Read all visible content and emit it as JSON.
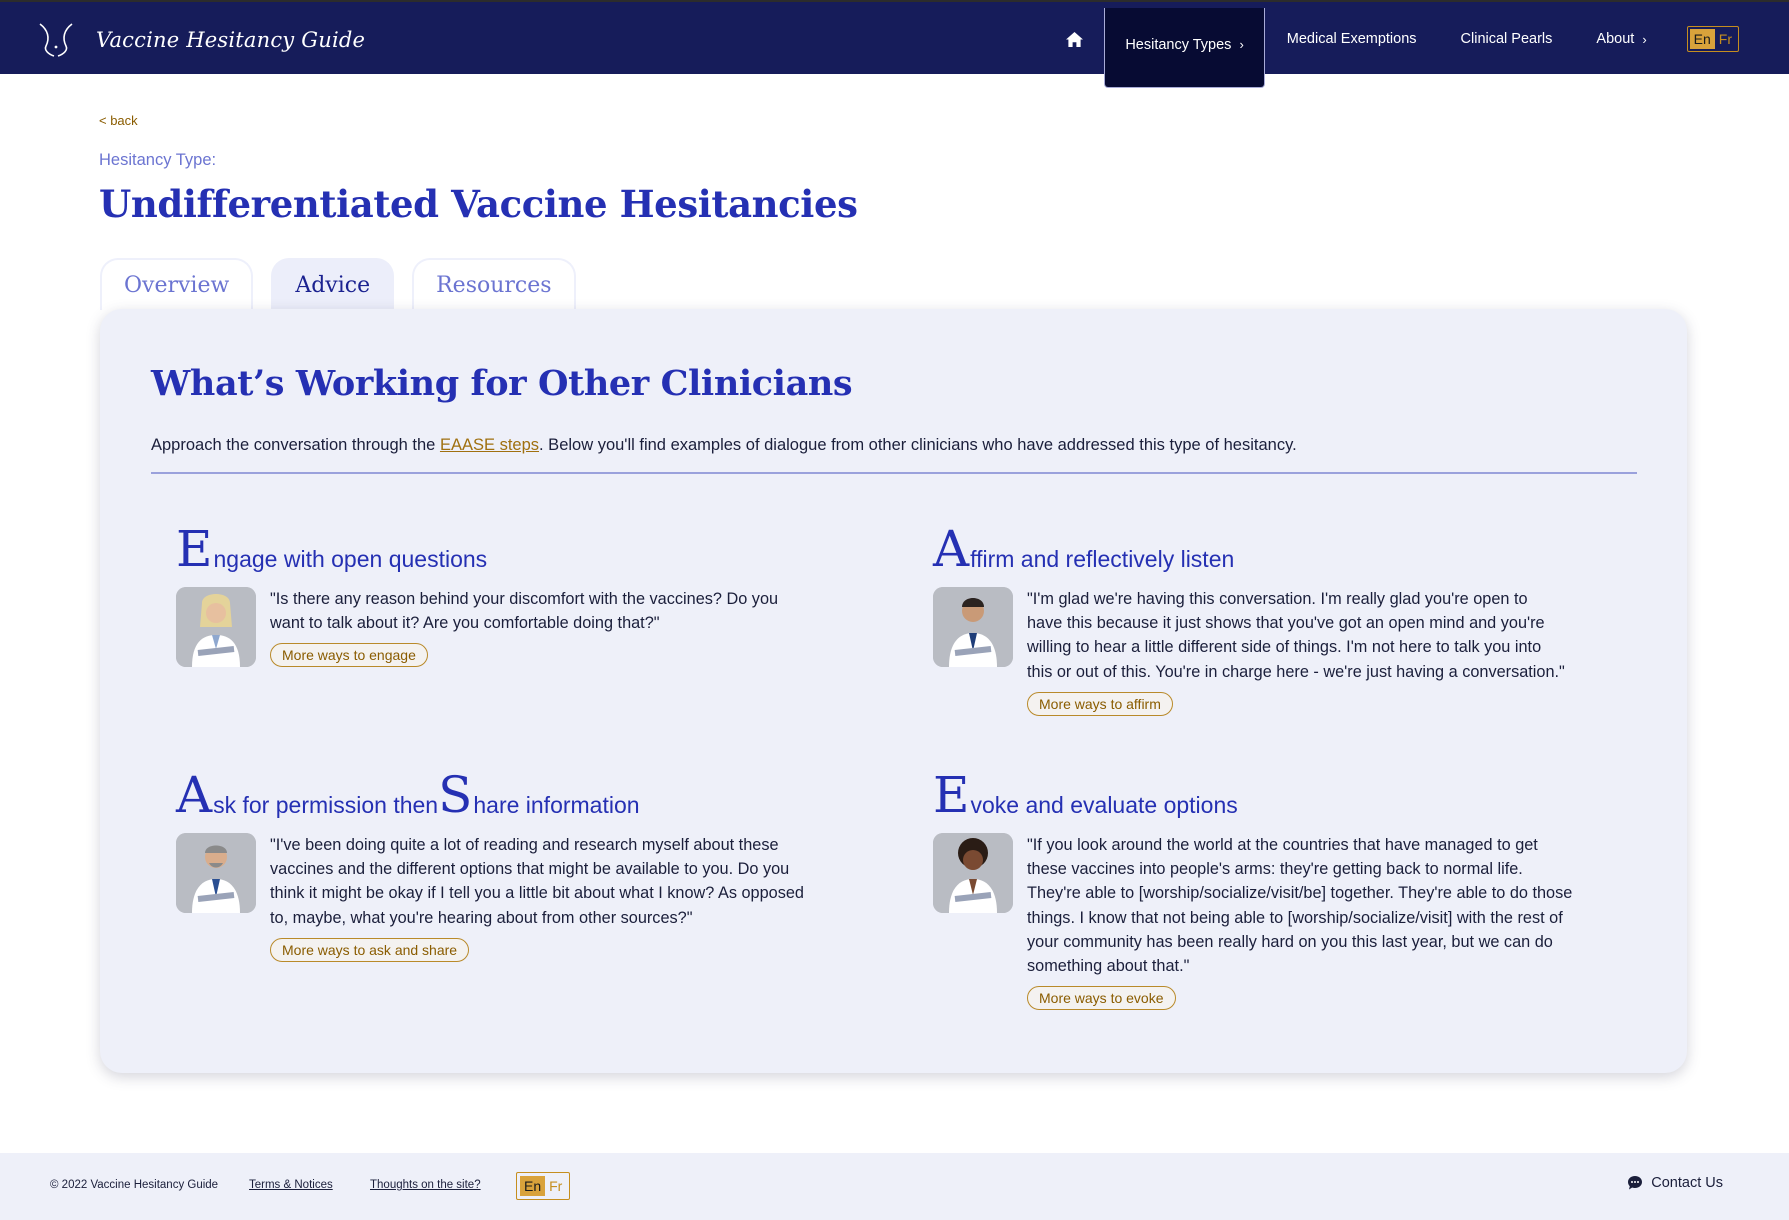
{
  "header": {
    "brand": "Vaccine Hesitancy Guide",
    "nav": [
      {
        "label": "Hesitancy Types",
        "active": true,
        "chevron": true
      },
      {
        "label": "Medical Exemptions",
        "active": false,
        "chevron": false
      },
      {
        "label": "Clinical Pearls",
        "active": false,
        "chevron": false
      },
      {
        "label": "About",
        "active": false,
        "chevron": true
      }
    ],
    "lang": {
      "en": "En",
      "fr": "Fr"
    }
  },
  "page": {
    "back": "< back",
    "type_label": "Hesitancy Type:",
    "title": "Undifferentiated Vaccine Hesitancies"
  },
  "tabs": [
    {
      "label": "Overview",
      "active": false
    },
    {
      "label": "Advice",
      "active": true
    },
    {
      "label": "Resources",
      "active": false
    }
  ],
  "card": {
    "title": "What’s Working for Other Clinicians",
    "intro_before": "Approach the conversation through the ",
    "intro_link": "EAASE steps",
    "intro_after": ". Below you'll find examples of dialogue from other clinicians who have addressed this type of hesitancy.",
    "steps": [
      {
        "initial": "E",
        "rest": "ngage with open questions",
        "quote": "\"Is there any reason behind your discomfort with the vaccines? Do you want to talk about it? Are you comfortable doing that?\"",
        "button": "More ways to engage"
      },
      {
        "initial": "A",
        "rest": "ffirm and reflectively listen",
        "quote": "\"I'm glad we're having this conversation. I'm really glad you're open to have this because it just shows that you've got an open mind and you're willing to hear a little different side of things. I'm not here to talk you into this or out of this. You're in charge here - we're just having a conversation.\"",
        "button": "More ways to affirm"
      },
      {
        "initial": "A",
        "rest": "sk for permission then ",
        "initial2": "S",
        "rest2": "hare information",
        "quote": "\"I've been doing quite a lot of reading and research myself about these vaccines and the different options that might be available to you. Do you think it might be okay if I tell you a little bit about what I know? As opposed to, maybe, what you're hearing about from other sources?\"",
        "button": "More ways to ask and share"
      },
      {
        "initial": "E",
        "rest": "voke and evaluate options",
        "quote": "\"If you look around the world at the countries that have managed to get these vaccines into people's arms: they're getting back to normal life. They're able to [worship/socialize/visit/be] together. They're able to do those things. I know that not being able to [worship/socialize/visit] with the rest of your community has been really hard on you this last year, but we can do something about that.\"",
        "button": "More ways to evoke"
      }
    ]
  },
  "footer": {
    "copyright": "© 2022 Vaccine Hesitancy Guide",
    "terms": "Terms & Notices",
    "thoughts": "Thoughts on the site?",
    "lang": {
      "en": "En",
      "fr": "Fr"
    },
    "contact": "Contact Us"
  },
  "colors": {
    "header_bg": "#161c5a",
    "title_blue": "#2530b3",
    "accent_gold": "#c58e1f",
    "card_bg": "#eef0f9"
  },
  "icons": [
    "logo-mark",
    "home-icon",
    "chevron-right-icon",
    "chat-bubble-icon"
  ]
}
